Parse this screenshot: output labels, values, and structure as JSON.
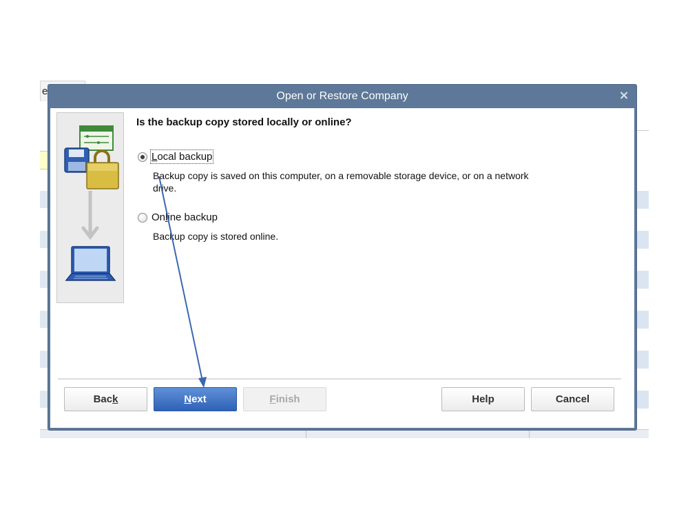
{
  "background_app": {
    "partial_tab_text": "e"
  },
  "dialog": {
    "title": "Open or Restore Company",
    "close_symbol": "×",
    "heading": "Is the backup copy stored locally or online?",
    "options": [
      {
        "label_first": "L",
        "label_rest": "ocal backup",
        "selected": true,
        "description": "Backup copy is saved on this computer, on a removable storage device, or on a network drive."
      },
      {
        "label_first": "On",
        "label_mid": "l",
        "label_rest": "ine backup",
        "selected": false,
        "description": "Backup copy is stored online."
      }
    ],
    "buttons": {
      "back": {
        "pre": "Bac",
        "mnemonic": "k",
        "post": ""
      },
      "next": {
        "pre": "",
        "mnemonic": "N",
        "post": "ext"
      },
      "finish": {
        "pre": "",
        "mnemonic": "F",
        "post": "inish",
        "enabled": false
      },
      "help": "Help",
      "cancel": "Cancel"
    }
  },
  "colors": {
    "titlebar": "#5d7898",
    "primary_button": "#3a6fc4",
    "annotation_arrow": "#3b67b0"
  },
  "icons": [
    "calendar-icon",
    "floppy-disk-icon",
    "lock-icon",
    "down-arrow-icon",
    "laptop-icon",
    "close-icon",
    "annotation-arrow"
  ]
}
